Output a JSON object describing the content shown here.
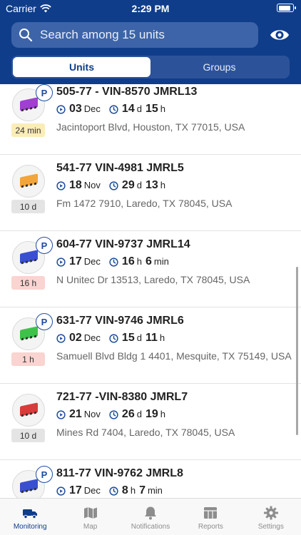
{
  "status_bar": {
    "carrier": "Carrier",
    "time": "2:29 PM",
    "battery_level": 0.9
  },
  "search": {
    "placeholder": "Search among 15 units"
  },
  "segments": {
    "units": "Units",
    "groups": "Groups",
    "selected": "Units"
  },
  "colors": {
    "header": "#0f3d8a",
    "accent": "#1d4c9d"
  },
  "units": [
    {
      "name": "505-77 - VIN-8570 JMRL13",
      "date_day": "03",
      "date_month": "Dec",
      "dur_a": "14",
      "dur_a_unit": "d",
      "dur_b": "15",
      "dur_b_unit": "h",
      "address": "Jacintoport Blvd, Houston, TX 77015, USA",
      "badge": "24 min",
      "badge_color": "yellow",
      "parked": true,
      "truck_color": "#a13fd2"
    },
    {
      "name": "541-77 VIN-4981 JMRL5",
      "date_day": "18",
      "date_month": "Nov",
      "dur_a": "29",
      "dur_a_unit": "d",
      "dur_b": "13",
      "dur_b_unit": "h",
      "address": "Fm 1472 7910, Laredo, TX 78045, USA",
      "badge": "10 d",
      "badge_color": "gray",
      "parked": false,
      "truck_color": "#f3a43a"
    },
    {
      "name": "604-77 VIN-9737 JMRL14",
      "date_day": "17",
      "date_month": "Dec",
      "dur_a": "16",
      "dur_a_unit": "h",
      "dur_b": "6",
      "dur_b_unit": "min",
      "address": "N Unitec Dr 13513, Laredo, TX 78045, USA",
      "badge": "16 h",
      "badge_color": "red",
      "parked": true,
      "truck_color": "#3a4fd0"
    },
    {
      "name": "631-77 VIN-9746 JMRL6",
      "date_day": "02",
      "date_month": "Dec",
      "dur_a": "15",
      "dur_a_unit": "d",
      "dur_b": "11",
      "dur_b_unit": "h",
      "address": "Samuell Blvd Bldg 1 4401, Mesquite, TX 75149, USA",
      "badge": "1 h",
      "badge_color": "red",
      "parked": true,
      "truck_color": "#3ec24a"
    },
    {
      "name": "721-77 -VIN-8380 JMRL7",
      "date_day": "21",
      "date_month": "Nov",
      "dur_a": "26",
      "dur_a_unit": "d",
      "dur_b": "19",
      "dur_b_unit": "h",
      "address": "Mines Rd 7404, Laredo, TX 78045, USA",
      "badge": "10 d",
      "badge_color": "gray",
      "parked": false,
      "truck_color": "#d93b3b"
    },
    {
      "name": "811-77 VIN-9762 JMRL8",
      "date_day": "17",
      "date_month": "Dec",
      "dur_a": "8",
      "dur_a_unit": "h",
      "dur_b": "7",
      "dur_b_unit": "min",
      "address": "",
      "badge": "",
      "badge_color": "gray",
      "parked": true,
      "truck_color": "#3a4fd0"
    }
  ],
  "tabs": [
    {
      "label": "Monitoring",
      "icon": "truck-icon",
      "active": true
    },
    {
      "label": "Map",
      "icon": "map-icon",
      "active": false
    },
    {
      "label": "Notifications",
      "icon": "bell-icon",
      "active": false
    },
    {
      "label": "Reports",
      "icon": "table-icon",
      "active": false
    },
    {
      "label": "Settings",
      "icon": "gear-icon",
      "active": false
    }
  ]
}
